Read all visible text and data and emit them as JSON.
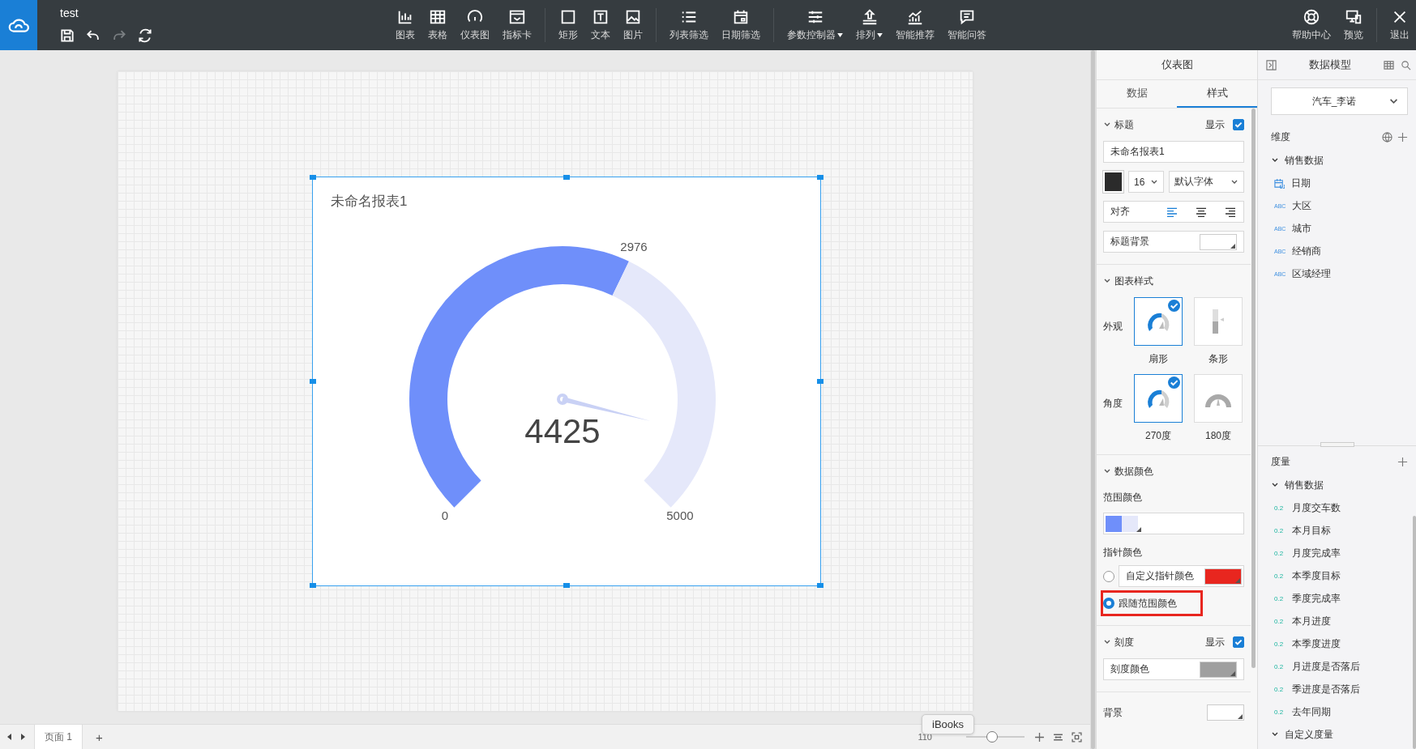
{
  "app": {
    "title": "test"
  },
  "quick_actions": [
    {
      "disabled": false
    },
    {
      "disabled": false
    },
    {
      "disabled": true
    },
    {
      "disabled": false
    }
  ],
  "toolbar": {
    "groups": [
      [
        {
          "label": "图表",
          "dropdown": false
        },
        {
          "label": "表格",
          "dropdown": false
        },
        {
          "label": "仪表图",
          "dropdown": false
        },
        {
          "label": "指标卡",
          "dropdown": false
        }
      ],
      [
        {
          "label": "矩形",
          "dropdown": false
        },
        {
          "label": "文本",
          "dropdown": false
        },
        {
          "label": "图片",
          "dropdown": false
        }
      ],
      [
        {
          "label": "列表筛选",
          "dropdown": false
        },
        {
          "label": "日期筛选",
          "dropdown": false
        }
      ],
      [
        {
          "label": "参数控制器",
          "dropdown": true
        },
        {
          "label": "排列",
          "dropdown": true
        },
        {
          "label": "智能推荐",
          "dropdown": false
        },
        {
          "label": "智能问答",
          "dropdown": false
        }
      ]
    ],
    "right": [
      {
        "label": "帮助中心"
      },
      {
        "label": "预览"
      }
    ],
    "exit": {
      "label": "退出"
    }
  },
  "widget": {
    "title": "未命名报表1",
    "selected": true,
    "gauge": {
      "min": "0",
      "max": "5000",
      "threshold": "2976",
      "value": "4425"
    }
  },
  "style_panel": {
    "title": "仪表图",
    "tabs": [
      {
        "label": "数据",
        "selected": false
      },
      {
        "label": "样式",
        "selected": true
      }
    ],
    "title_section": {
      "heading": "标题",
      "show_label": "显示",
      "show": true,
      "text_value": "未命名报表1",
      "font_size": "16",
      "font_family": "默认字体",
      "align_label": "对齐",
      "align": [
        {
          "selected": true
        },
        {
          "selected": false
        },
        {
          "selected": false
        }
      ],
      "bg_label": "标题背景"
    },
    "chart_style": {
      "heading": "图表样式",
      "appearance": {
        "label": "外观",
        "options": [
          {
            "label": "扇形",
            "selected": true
          },
          {
            "label": "条形",
            "selected": false
          }
        ]
      },
      "angle": {
        "label": "角度",
        "options": [
          {
            "label": "270度",
            "selected": true
          },
          {
            "label": "180度",
            "selected": false
          }
        ]
      }
    },
    "data_color": {
      "heading": "数据颜色",
      "range_label": "范围颜色",
      "range_colors": [
        {
          "color": "#6f8ffa"
        },
        {
          "color": "#e5e8fa"
        }
      ],
      "pointer_label": "指针颜色",
      "pointer_options": [
        {
          "label": "自定义指针颜色",
          "selected": false,
          "highlighted": false,
          "color": "#e8261f"
        },
        {
          "label": "跟随范围颜色",
          "selected": true,
          "highlighted": true
        }
      ]
    },
    "scale": {
      "heading": "刻度",
      "show_label": "显示",
      "show": true,
      "color_label": "刻度颜色"
    },
    "background": {
      "label": "背景"
    }
  },
  "model_panel": {
    "title": "数据模型",
    "dataset": "汽车_李诺",
    "dimensions": {
      "heading": "维度",
      "groups": [
        {
          "label": "销售数据",
          "expanded": true,
          "children": [
            {
              "kind": "date",
              "label": "日期"
            },
            {
              "kind": "text",
              "badge": "ABC",
              "label": "大区"
            },
            {
              "kind": "text",
              "badge": "ABC",
              "label": "城市"
            },
            {
              "kind": "text",
              "badge": "ABC",
              "label": "经销商"
            },
            {
              "kind": "text",
              "badge": "ABC",
              "label": "区域经理"
            }
          ]
        }
      ]
    },
    "measures": {
      "heading": "度量",
      "groups": [
        {
          "label": "销售数据",
          "expanded": true,
          "children": [
            {
              "kind": "number",
              "badge": "0.2",
              "label": "月度交车数"
            },
            {
              "kind": "number",
              "badge": "0.2",
              "label": "本月目标"
            },
            {
              "kind": "number",
              "badge": "0.2",
              "label": "月度完成率"
            },
            {
              "kind": "number",
              "badge": "0.2",
              "label": "本季度目标"
            },
            {
              "kind": "number",
              "badge": "0.2",
              "label": "季度完成率"
            },
            {
              "kind": "number",
              "badge": "0.2",
              "label": "本月进度"
            },
            {
              "kind": "number",
              "badge": "0.2",
              "label": "本季度进度"
            },
            {
              "kind": "number",
              "badge": "0.2",
              "label": "月进度是否落后"
            },
            {
              "kind": "number",
              "badge": "0.2",
              "label": "季进度是否落后"
            },
            {
              "kind": "number",
              "badge": "0.2",
              "label": "去年同期"
            }
          ]
        },
        {
          "label": "自定义度量",
          "expanded": true
        }
      ]
    }
  },
  "bottom_bar": {
    "pages": [
      {
        "label": "页面 1",
        "selected": true
      }
    ],
    "add": "+",
    "zoom_reading": "110",
    "zoom_slider": {
      "level": 0.45
    },
    "tooltip": "iBooks"
  }
}
